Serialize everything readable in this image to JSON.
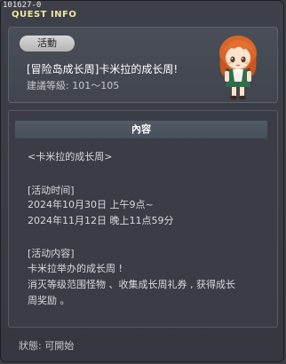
{
  "window": {
    "quest_id": "101627-0",
    "title": "QUEST INFO"
  },
  "header": {
    "category": "活動",
    "quest_name": "[冒险岛成长周]卡米拉的成长周!",
    "level_range": "建議等級: 101～105"
  },
  "content": {
    "heading": "內容",
    "lines": [
      "<卡米拉的成长周>",
      "[活动时间]",
      "2024年10月30日 上午9点~",
      "2024年11月12日 晚上11点59分",
      "[活动内容]",
      "卡米拉举办的成长周 !",
      "消灭等级范围怪物 、收集成长周礼券 , 获得成长",
      "周奖励 。"
    ]
  },
  "status": {
    "text": "狀態: 可開始"
  },
  "icons": {
    "npc": "npc-camilla-portrait-icon"
  }
}
